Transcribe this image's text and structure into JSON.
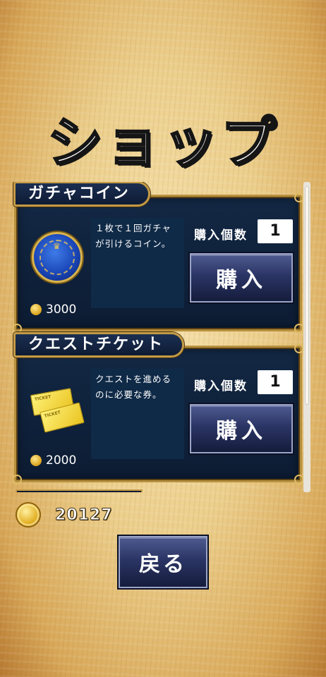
{
  "page_title": "ショップ",
  "items": [
    {
      "name": "ガチャコイン",
      "description": "１枚で１回ガチャが引けるコイン。",
      "quantity_label": "購入個数",
      "quantity": "1",
      "buy_label": "購入",
      "price": "3000",
      "icon": "gacha-coin-medal"
    },
    {
      "name": "クエストチケット",
      "description": "クエストを進めるのに必要な券。",
      "quantity_label": "購入個数",
      "quantity": "1",
      "buy_label": "購入",
      "price": "2000",
      "icon": "quest-ticket",
      "ticket_text": "TICKET"
    }
  ],
  "wallet": {
    "amount": "20127",
    "icon": "gold-coin"
  },
  "back_label": "戻る",
  "colors": {
    "panel": "#132844",
    "frame_gold": "#b8913e",
    "button": "#2b3565",
    "parchment": "#eccf8c"
  }
}
